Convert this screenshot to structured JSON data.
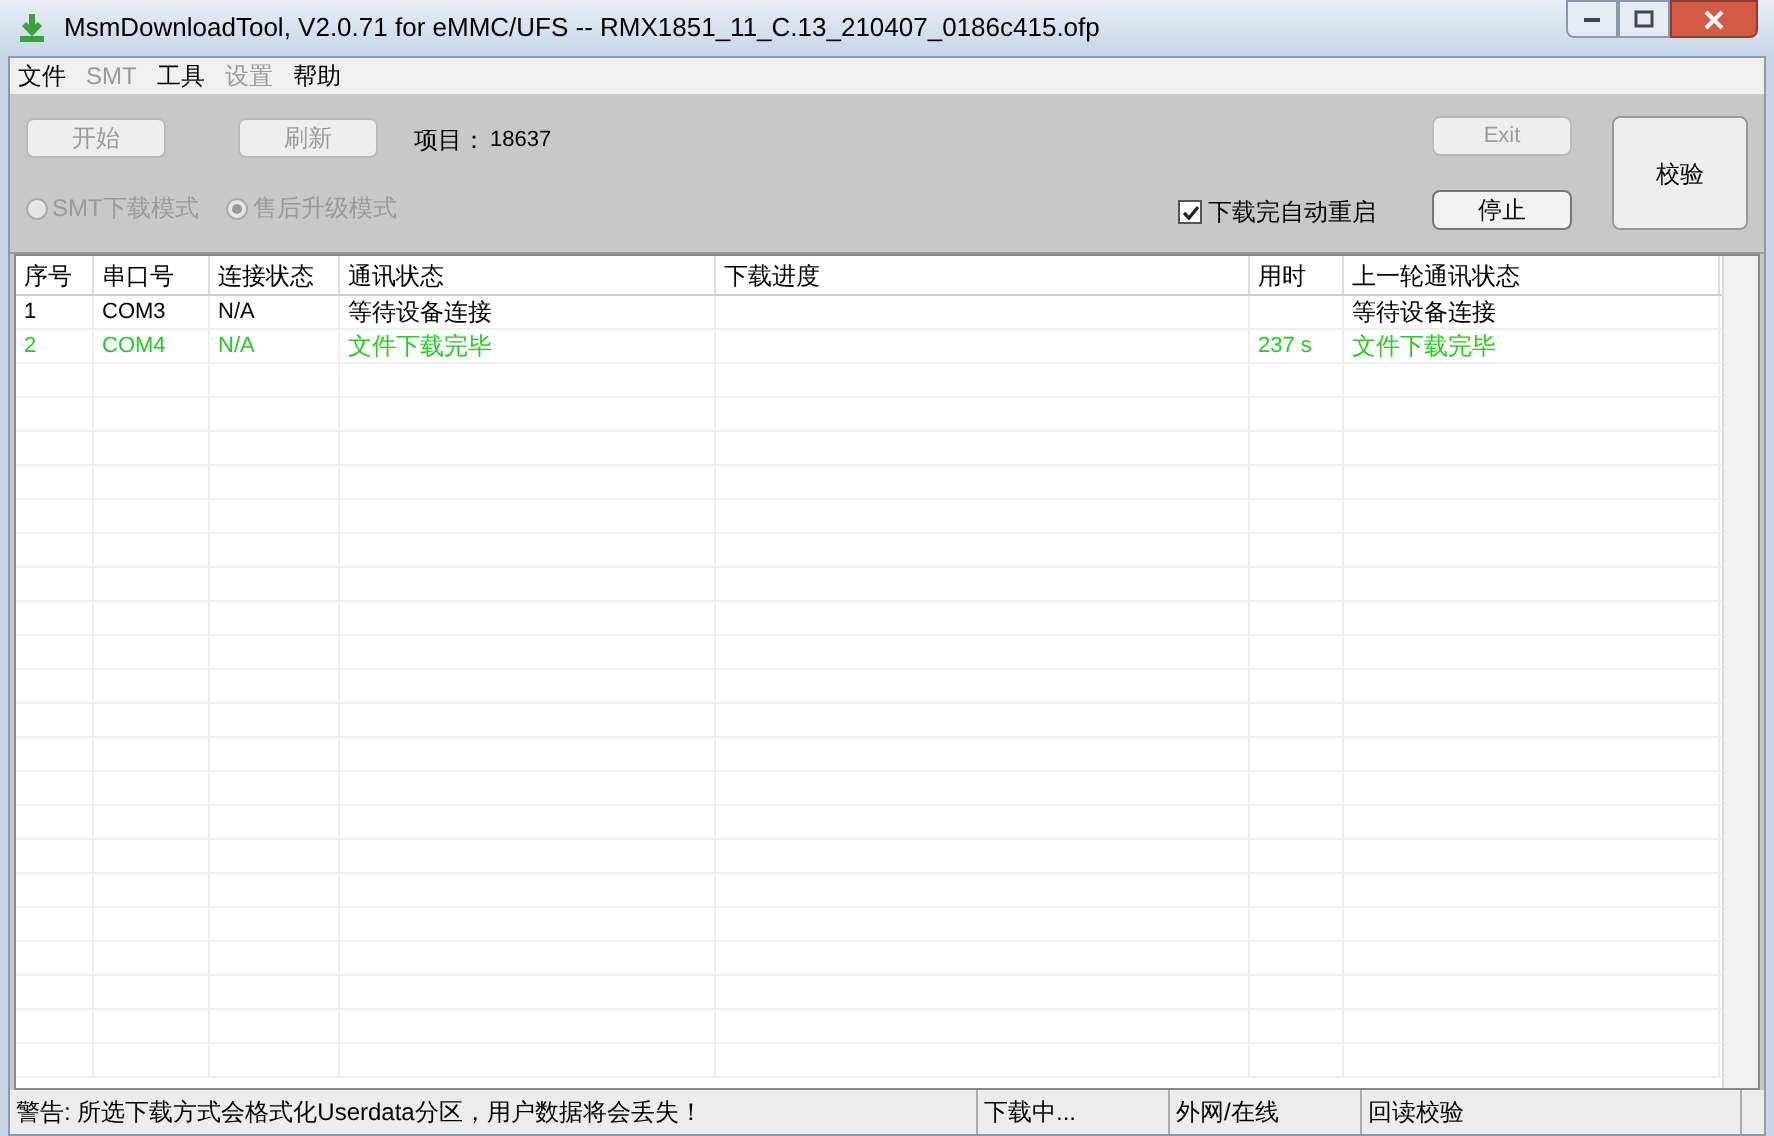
{
  "window": {
    "title": "MsmDownloadTool, V2.0.71 for eMMC/UFS -- RMX1851_11_C.13_210407_0186c415.ofp"
  },
  "menu": [
    {
      "label": "文件",
      "disabled": false
    },
    {
      "label": "SMT",
      "disabled": true
    },
    {
      "label": "工具",
      "disabled": false
    },
    {
      "label": "设置",
      "disabled": true
    },
    {
      "label": "帮助",
      "disabled": false
    }
  ],
  "toolbar": {
    "start_button": {
      "label": "开始",
      "disabled": true
    },
    "refresh_button": {
      "label": "刷新",
      "disabled": true
    },
    "project_label": "项目：",
    "project_value": "18637",
    "exit_button": {
      "label": "Exit",
      "disabled": true
    },
    "stop_button": {
      "label": "停止",
      "disabled": false
    },
    "verify_button": {
      "label": "校验",
      "disabled": false
    },
    "modes": [
      {
        "label": "SMT下载模式",
        "selected": false,
        "disabled": true
      },
      {
        "label": "售后升级模式",
        "selected": true,
        "disabled": true
      }
    ],
    "auto_reboot": {
      "label": "下载完自动重启",
      "checked": true
    }
  },
  "table": {
    "columns": [
      "序号",
      "串口号",
      "连接状态",
      "通讯状态",
      "下载进度",
      "用时",
      "上一轮通讯状态"
    ],
    "rows": [
      {
        "cells": [
          "1",
          "COM3",
          "N/A",
          "等待设备连接",
          "",
          "",
          "等待设备连接"
        ],
        "color": "#000000"
      },
      {
        "cells": [
          "2",
          "COM4",
          "N/A",
          "文件下载完毕",
          "",
          "237 s",
          "文件下载完毕"
        ],
        "color": "#22cc22"
      }
    ]
  },
  "status_bar": [
    "警告: 所选下载方式会格式化Userdata分区，用户数据将会丢失！",
    "下载中...",
    "外网/在线",
    "回读校验"
  ]
}
